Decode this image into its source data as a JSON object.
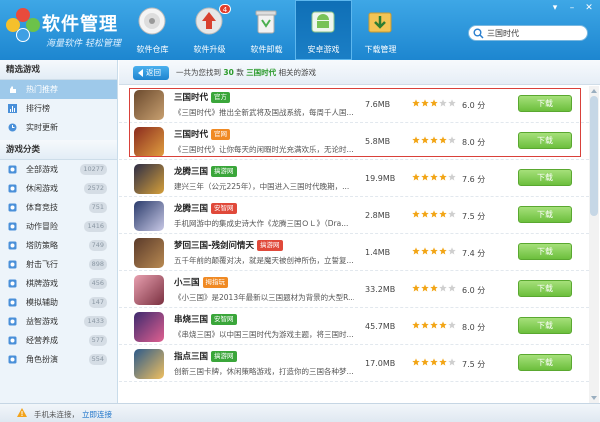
{
  "app": {
    "title": "软件管理",
    "slogan": "海量软件 轻松管理"
  },
  "nav": [
    {
      "label": "软件仓库",
      "icon": "disc-icon"
    },
    {
      "label": "软件升级",
      "icon": "upgrade-icon",
      "badge": "4"
    },
    {
      "label": "软件卸载",
      "icon": "recycle-bin-icon"
    },
    {
      "label": "安卓游戏",
      "icon": "android-game-icon"
    },
    {
      "label": "下载管理",
      "icon": "download-folder-icon"
    }
  ],
  "search": {
    "value": "三国时代"
  },
  "sidebar": {
    "section1": "精选游戏",
    "featured": [
      {
        "label": "热门推荐",
        "icon": "hand-icon"
      },
      {
        "label": "排行榜",
        "icon": "ranking-icon"
      },
      {
        "label": "实时更新",
        "icon": "clock-icon"
      }
    ],
    "section2": "游戏分类",
    "categories": [
      {
        "label": "全部游戏",
        "count": "10277"
      },
      {
        "label": "休闲游戏",
        "count": "2572"
      },
      {
        "label": "体育竞技",
        "count": "751"
      },
      {
        "label": "动作冒险",
        "count": "1416"
      },
      {
        "label": "塔防策略",
        "count": "749"
      },
      {
        "label": "射击飞行",
        "count": "898"
      },
      {
        "label": "棋牌游戏",
        "count": "456"
      },
      {
        "label": "模拟辅助",
        "count": "147"
      },
      {
        "label": "益智游戏",
        "count": "1433"
      },
      {
        "label": "经营养成",
        "count": "577"
      },
      {
        "label": "角色扮演",
        "count": "554"
      }
    ]
  },
  "topbar": {
    "back_label": "返回",
    "result_prefix": "一共为您找到",
    "result_count": "30",
    "result_unit": "款",
    "result_keyword": "三国时代",
    "result_suffix": "相关的游戏"
  },
  "games": [
    {
      "name": "三国时代",
      "tag": "官方",
      "tag_color": "#3aa63a",
      "desc": "《三国时代》推出全新武将及国战系统，每周千人国...",
      "size": "7.6MB",
      "stars": 3,
      "score": "6.0 分",
      "btn": "下载"
    },
    {
      "name": "三国时代",
      "tag": "官网",
      "tag_color": "#f08a24",
      "desc": "《三国时代》让你每天的闲暇时光充满欢乐，无论时...",
      "size": "5.8MB",
      "stars": 4,
      "score": "8.0 分",
      "btn": "下载"
    },
    {
      "name": "龙腾三国",
      "tag": "搞游网",
      "tag_color": "#3aa63a",
      "desc": "建兴三年（公元225年），中国进入三国时代晚期，...",
      "size": "19.9MB",
      "stars": 4,
      "score": "7.6 分",
      "btn": "下载"
    },
    {
      "name": "龙腾三国",
      "tag": "安智网",
      "tag_color": "#e0493a",
      "desc": "手机网游中的集成史诗大作《龙腾三国ＯＬ》（Dra...",
      "size": "2.8MB",
      "stars": 4,
      "score": "7.5 分",
      "btn": "下载"
    },
    {
      "name": "梦回三国-残剑问情天",
      "tag": "搞游网",
      "tag_color": "#e0493a",
      "desc": "五千年前的颠覆对决，就是魔天被创神所伤，立誓复...",
      "size": "1.4MB",
      "stars": 4,
      "score": "7.4 分",
      "btn": "下载"
    },
    {
      "name": "小三国",
      "tag": "拇指玩",
      "tag_color": "#f08a24",
      "desc": "《小三国》是2013年最新以三国题材为背景的大型R...",
      "size": "33.2MB",
      "stars": 3,
      "score": "6.0 分",
      "btn": "下载"
    },
    {
      "name": "串烧三国",
      "tag": "安智网",
      "tag_color": "#3aa63a",
      "desc": "《串烧三国》以中国三国时代为游戏主题，将三国时...",
      "size": "45.7MB",
      "stars": 4,
      "score": "8.0 分",
      "btn": "下载"
    },
    {
      "name": "指点三国",
      "tag": "搞游网",
      "tag_color": "#3aa63a",
      "desc": "创新三国卡牌，休闲策略游戏，打造你的三国各种梦...",
      "size": "17.0MB",
      "stars": 4,
      "score": "7.5 分",
      "btn": "下载"
    }
  ],
  "footer": {
    "status": "手机未连接，",
    "link": "立即连接"
  }
}
